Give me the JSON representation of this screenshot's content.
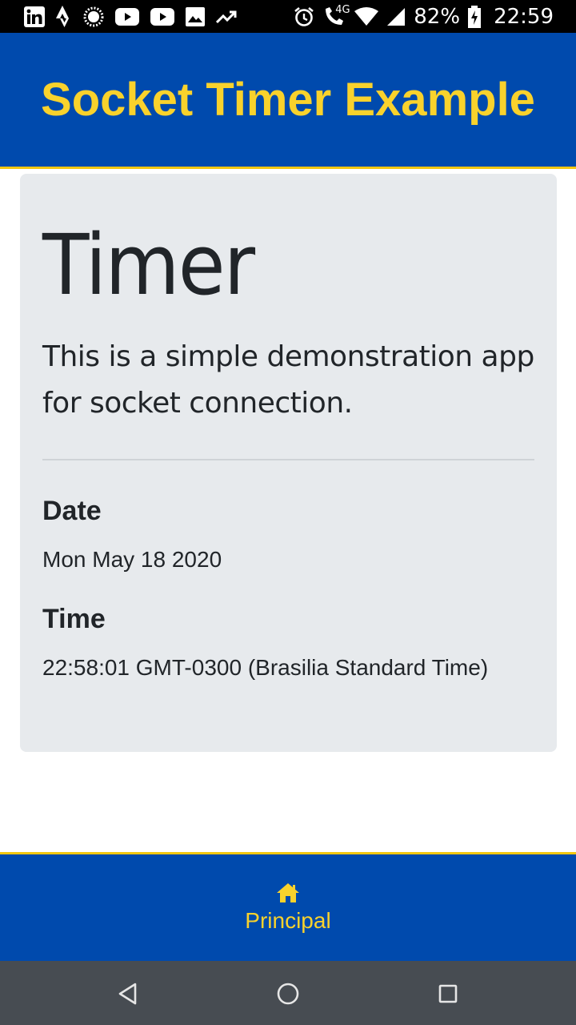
{
  "status_bar": {
    "left_icons": [
      "linkedin-icon",
      "strava-icon",
      "loading-icon",
      "youtube-icon",
      "youtube-icon",
      "image-icon",
      "trending-icon"
    ],
    "right_icons": [
      "alarm-icon",
      "volte-call-icon",
      "wifi-icon",
      "signal-icon",
      "battery-charging-icon"
    ],
    "network": "4G",
    "battery": "82%",
    "time": "22:59"
  },
  "header": {
    "title": "Socket Timer Example"
  },
  "card": {
    "title": "Timer",
    "lead": "This is a simple demonstration app for socket connection.",
    "date_label": "Date",
    "date_value": "Mon May 18 2020",
    "time_label": "Time",
    "time_value": "22:58:01 GMT-0300 (Brasilia Standard Time)"
  },
  "tab_bar": {
    "tabs": [
      {
        "label": "Principal",
        "icon": "home-icon"
      }
    ]
  },
  "nav_bar": {
    "buttons": [
      "back-icon",
      "home-circle-icon",
      "recents-icon"
    ]
  },
  "colors": {
    "primary": "#004aad",
    "accent": "#f9d22c",
    "card_bg": "#e7eaed",
    "nav_bg": "#474c52"
  }
}
